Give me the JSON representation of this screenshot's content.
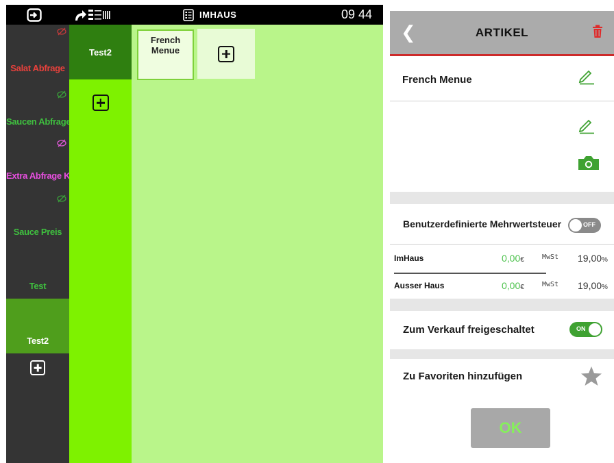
{
  "topbar": {
    "mode_label": "IMHAUS",
    "clock": "09 44"
  },
  "categories": [
    {
      "label": "Salat Abfrage",
      "color": "#e8413c",
      "eye_color": "#c13a3a",
      "hidden": true
    },
    {
      "label": "Saucen Abfrage",
      "color": "#3fbf3f",
      "eye_color": "#3a9e3a",
      "hidden": true
    },
    {
      "label": "Extra Abfrage Kl",
      "color": "#e84fe0",
      "eye_color": "#e05ad8",
      "hidden": true
    },
    {
      "label": "Sauce Preis",
      "color": "#3fbf3f",
      "eye_color": "#3a9e3a",
      "hidden": true
    },
    {
      "label": "Test",
      "color": "#3fbf3f",
      "hidden": false
    },
    {
      "label": "Test2",
      "color": "#ffffff",
      "hidden": false,
      "selected": true
    }
  ],
  "subcategories": {
    "selected_label": "Test2"
  },
  "articles": [
    {
      "label": "French\nMenue"
    }
  ],
  "panel": {
    "title": "ARTIKEL",
    "article_name": "French Menue",
    "custom_vat_label": "Benutzerdefinierte Mehrwertsteuer",
    "custom_vat_toggle": "OFF",
    "tax_rows": [
      {
        "name": "ImHaus",
        "price": "0,00",
        "currency": "€",
        "vat_label": "MwSt",
        "vat": "19,00",
        "vat_unit": "%"
      },
      {
        "name": "Ausser Haus",
        "price": "0,00",
        "currency": "€",
        "vat_label": "MwSt",
        "vat": "19,00",
        "vat_unit": "%"
      }
    ],
    "sale_label": "Zum Verkauf freigeschaltet",
    "sale_toggle": "ON",
    "favorite_label": "Zu Favoriten hinzufügen",
    "ok_label": "OK"
  },
  "colors": {
    "accent_green": "#7ef200",
    "dark_green": "#2f7f10",
    "header_red": "#cc2a2a"
  }
}
